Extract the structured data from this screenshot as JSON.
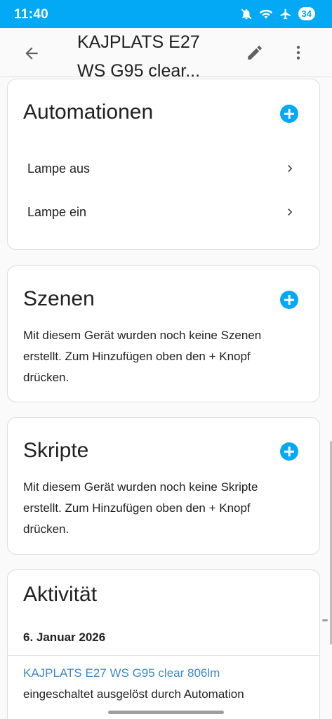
{
  "status_bar": {
    "time": "11:40",
    "battery": "34",
    "icons": [
      "mute-icon",
      "wifi-icon",
      "airplane-icon",
      "battery-icon"
    ],
    "background": "#03a9f4"
  },
  "app_bar": {
    "title_line1": "KAJPLATS E27",
    "title_line2": "WS G95 clear...",
    "icons": [
      "back-arrow-icon",
      "pencil-icon",
      "more-vert-icon"
    ]
  },
  "automations": {
    "title": "Automationen",
    "items": [
      {
        "label": "Lampe aus"
      },
      {
        "label": "Lampe ein"
      }
    ]
  },
  "scenes": {
    "title": "Szenen",
    "empty_line1": "Mit diesem Gerät wurden noch keine Szenen",
    "empty_line2": "erstellt. Zum Hinzufügen oben den + Knopf",
    "empty_line3": "drücken."
  },
  "scripts": {
    "title": "Skripte",
    "empty_line1": "Mit diesem Gerät wurden noch keine Skripte",
    "empty_line2": "erstellt. Zum Hinzufügen oben den + Knopf",
    "empty_line3": "drücken."
  },
  "activity": {
    "title": "Aktivität",
    "date": "6. Januar 2026",
    "entry_link": "KAJPLATS E27 WS G95 clear 806lm",
    "entry_text": "eingeschaltet ausgelöst durch Automation"
  },
  "colors": {
    "accent": "#03a9f4",
    "link": "#3f87c4"
  }
}
